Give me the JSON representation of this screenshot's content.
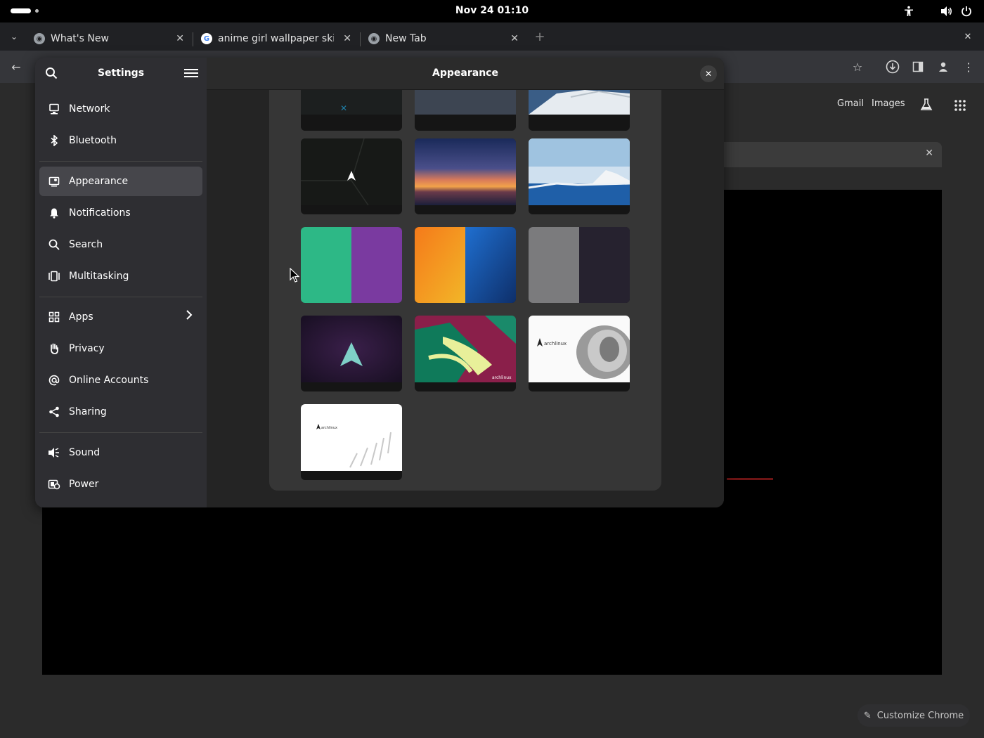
{
  "topbar": {
    "clock": "Nov 24  01:10",
    "icons": [
      "activities-pill",
      "accessibility-icon",
      "volume-icon",
      "power-icon"
    ]
  },
  "browser": {
    "tabs": [
      {
        "label": "What's New",
        "icon": "chrome-icon"
      },
      {
        "label": "anime girl wallpaper skin",
        "icon": "google-icon"
      },
      {
        "label": "New Tab",
        "icon": "chrome-icon"
      }
    ],
    "new_tab_glyph": "+",
    "links": {
      "gmail": "Gmail",
      "images": "Images"
    },
    "customize_label": "Customize Chrome"
  },
  "settings": {
    "title": "Settings",
    "page_title": "Appearance",
    "sidebar": [
      {
        "label": "Network",
        "icon": "network-icon"
      },
      {
        "label": "Bluetooth",
        "icon": "bluetooth-icon"
      },
      {
        "label": "Appearance",
        "icon": "appearance-icon",
        "active": true
      },
      {
        "label": "Notifications",
        "icon": "bell-icon"
      },
      {
        "label": "Search",
        "icon": "search-icon"
      },
      {
        "label": "Multitasking",
        "icon": "multitasking-icon"
      },
      {
        "label": "Apps",
        "icon": "apps-icon",
        "has_submenu": true
      },
      {
        "label": "Privacy",
        "icon": "hand-icon"
      },
      {
        "label": "Online Accounts",
        "icon": "at-icon"
      },
      {
        "label": "Sharing",
        "icon": "share-icon"
      },
      {
        "label": "Sound",
        "icon": "speaker-icon"
      },
      {
        "label": "Power",
        "icon": "power-icon"
      }
    ],
    "wallpapers": [
      {
        "name": "wallpaper-dark-blue-accent"
      },
      {
        "name": "wallpaper-slate"
      },
      {
        "name": "wallpaper-snow"
      },
      {
        "name": "wallpaper-dark-arch-geometric"
      },
      {
        "name": "wallpaper-sunset"
      },
      {
        "name": "wallpaper-glacier"
      },
      {
        "name": "wallpaper-green-purple"
      },
      {
        "name": "wallpaper-orange-blue-texture"
      },
      {
        "name": "wallpaper-gray-navy"
      },
      {
        "name": "wallpaper-arch-purple"
      },
      {
        "name": "wallpaper-tropical-leaves",
        "caption": "archlinux"
      },
      {
        "name": "wallpaper-archlinux-shell",
        "caption": "archlinux"
      },
      {
        "name": "wallpaper-archlinux-white",
        "caption": "archlinux"
      }
    ]
  }
}
